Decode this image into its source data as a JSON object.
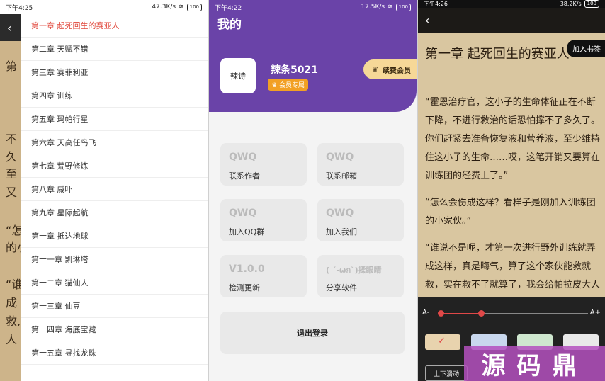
{
  "panel1": {
    "status": {
      "time": "下午4:25",
      "speed": "47.3K/s",
      "battery": "100"
    },
    "bg_chars": [
      "第",
      "不",
      "久",
      "至",
      "又",
      "“怎",
      "的小",
      "“谁",
      "成",
      "救,",
      "人"
    ],
    "chapters": [
      "第一章 起死回生的赛亚人",
      "第二章 天赋不错",
      "第三章 赛菲利亚",
      "第四章 训练",
      "第五章 玛帕行星",
      "第六章 天高任鸟飞",
      "第七章 荒野修炼",
      "第八章 威吓",
      "第九章 星际起航",
      "第十章 抵达地球",
      "第十一章 凯琳塔",
      "第十二章 猫仙人",
      "第十三章 仙豆",
      "第十四章 海底宝藏",
      "第十五章 寻找龙珠"
    ]
  },
  "panel2": {
    "status": {
      "time": "下午4:22",
      "speed": "17.5K/s",
      "battery": "100"
    },
    "title": "我的",
    "avatar_text": "辣诗",
    "username": "辣条5021",
    "vip_badge": "会员专属",
    "renew_label": "续费会员",
    "cards": [
      {
        "big": "QWQ",
        "label": "联系作者"
      },
      {
        "big": "QWQ",
        "label": "联系邮箱"
      },
      {
        "big": "QWQ",
        "label": "加入QQ群"
      },
      {
        "big": "QWQ",
        "label": "加入我们"
      },
      {
        "big": "V1.0.0",
        "label": "检测更新"
      },
      {
        "big": "( ´-ωก`)揉眼睛",
        "label": "分享软件"
      }
    ],
    "logout": "退出登录"
  },
  "panel3": {
    "status": {
      "time": "下午4:26",
      "speed": "38.2K/s",
      "battery": "100"
    },
    "bookmark": "加入书签",
    "chapter_title": "第一章 起死回生的赛亚人",
    "paragraphs": [
      "“霍恩治疗官，这小子的生命体征正在不断下降，不进行救治的话恐怕撑不了多久了。你们赶紧去准备恢复液和营养液，至少维持住这小子的生命……哎，这笔开销又要算在训练团的经费上了。”",
      "“怎么会伤成这样？看样子是刚加入训练团的小家伙。”",
      "“谁说不是呢，才第一次进行野外训练就弄成这样，真是晦气，算了这个家伙能救就救，实在救不了就算了，我会给帕拉皮大人报告的。”"
    ],
    "font_minus": "A-",
    "font_plus": "A+",
    "font_level": 0.28,
    "swatches": [
      "#e8d3ae",
      "#c9d8ee",
      "#cfe7cf",
      "#e9e9e9"
    ],
    "check": "✓",
    "scroll_mode": "上下滑动",
    "watermark": "源码鼎"
  }
}
